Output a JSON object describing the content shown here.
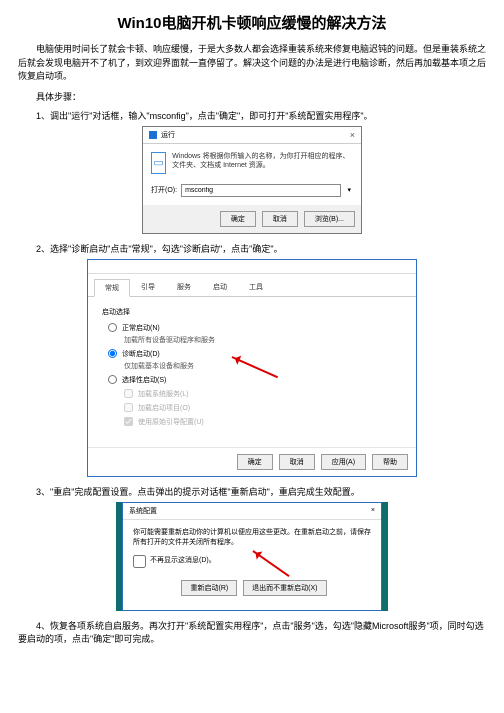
{
  "title": "Win10电脑开机卡顿响应缓慢的解决方法",
  "intro": "电脑使用时间长了就会卡顿、响应缓慢，于是大多数人都会选择重装系统来修复电脑迟钝的问题。但是重装系统之后就会发现电脑开不了机了，到欢迎界面就一直停留了。解决这个问题的办法是进行电脑诊断，然后再加载基本项之后恢复启动项。",
  "steps_label": "具体步骤：",
  "step1": "1、调出\"运行\"对话框，输入\"msconfig\"，点击\"确定\"，即可打开\"系统配置实用程序\"。",
  "step2": "2、选择\"诊断启动\"点击\"常规\"，勾选\"诊断启动\"，点击\"确定\"。",
  "step3": "3、\"重启\"完成配置设置。点击弹出的提示对话框\"重新启动\"，重启完成生效配置。",
  "step4": "4、恢复各项系统自启服务。再次打开\"系统配置实用程序\"，点击\"服务\"选，勾选\"隐藏Microsoft服务\"项，同时勾选要启动的项，点击\"确定\"即可完成。",
  "run_dialog": {
    "title": "运行",
    "hint": "Windows 将根据你所输入的名称，为你打开相应的程序、文件夹、文档或 Internet 资源。",
    "open_label": "打开(O):",
    "value": "msconfig",
    "ok": "确定",
    "cancel": "取消",
    "browse": "浏览(B)..."
  },
  "msconfig": {
    "tabs": [
      "常规",
      "引导",
      "服务",
      "启动",
      "工具"
    ],
    "group": "启动选择",
    "opt_normal": "正常启动(N)",
    "opt_normal_sub": "加载所有设备驱动程序和服务",
    "opt_diag": "诊断启动(D)",
    "opt_diag_sub": "仅加载基本设备和服务",
    "opt_sel": "选择性启动(S)",
    "sel_sub1": "加载系统服务(L)",
    "sel_sub2": "加载启动项目(O)",
    "sel_sub3": "使用原始引导配置(U)",
    "ok": "确定",
    "cancel": "取消",
    "apply": "应用(A)",
    "help": "帮助"
  },
  "restart": {
    "title": "系统配置",
    "msg": "你可能需要重新启动你的计算机以便应用这些更改。在重新启动之前，请保存所有打开的文件并关闭所有程序。",
    "dont_show": "不再显示这消息(D)。",
    "restart_btn": "重新启动(R)",
    "exit_btn": "退出而不重新启动(X)"
  }
}
